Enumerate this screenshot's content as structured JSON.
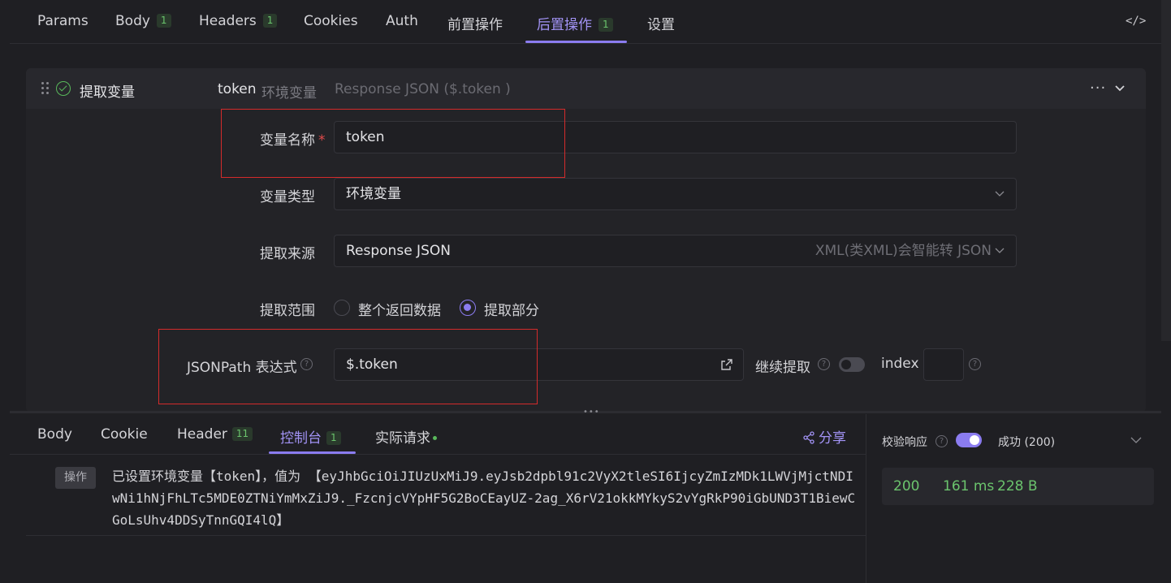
{
  "top_tabs": [
    {
      "label": "Params",
      "badge": ""
    },
    {
      "label": "Body",
      "badge": "1"
    },
    {
      "label": "Headers",
      "badge": "1"
    },
    {
      "label": "Cookies",
      "badge": ""
    },
    {
      "label": "Auth",
      "badge": ""
    },
    {
      "label": "前置操作",
      "badge": ""
    },
    {
      "label": "后置操作",
      "badge": "1"
    },
    {
      "label": "设置",
      "badge": ""
    }
  ],
  "active_top_tab": "后置操作",
  "code_icon_glyph": "</>",
  "extract": {
    "title": "提取变量",
    "summary_name": "token",
    "summary_type": "环境变量",
    "summary_source": "Response JSON ($.token )",
    "more_glyph": "···",
    "fields": {
      "var_name_label": "变量名称",
      "required_mark": "*",
      "var_name_value": "token",
      "var_type_label": "变量类型",
      "var_type_value": "环境变量",
      "source_label": "提取来源",
      "source_value": "Response JSON",
      "source_hint": "XML(类XML)会智能转 JSON",
      "range_label": "提取范围",
      "range_options": [
        "整个返回数据",
        "提取部分"
      ],
      "range_selected": "提取部分",
      "jsonpath_label": "JSONPath 表达式",
      "jsonpath_value": "$.token",
      "continue_label": "继续提取",
      "continue_enabled": false,
      "index_label": "index",
      "index_value": ""
    }
  },
  "bottom_tabs": [
    {
      "label": "Body",
      "badge": ""
    },
    {
      "label": "Cookie",
      "badge": ""
    },
    {
      "label": "Header",
      "badge": "11"
    },
    {
      "label": "控制台",
      "badge": "1"
    },
    {
      "label": "实际请求",
      "badge": ""
    }
  ],
  "active_bottom_tab": "控制台",
  "share_label": "分享",
  "console": {
    "tag": "操作",
    "message": "已设置环境变量【token】，值为 【eyJhbGciOiJIUzUxMiJ9.eyJsb2dpbl91c2VyX2tleSI6IjcyZmIzMDk1LWVjMjctNDIwNi1hNjFhLTc5MDE0ZTNiYmMxZiJ9._FzcnjcVYpHF5G2BoCEayUZ-2ag_X6rV21okkMYkyS2vYgRkP90iGbUND3T1BiewCGoLsUhv4DDSyTnnGQI4lQ】"
  },
  "verify": {
    "label": "校验响应",
    "enabled": true,
    "status": "成功 (200)"
  },
  "metrics": {
    "status_code": "200",
    "time": "161 ms",
    "size": "228 B"
  },
  "colors": {
    "accent": "#8b7cf0",
    "success": "#6bc46d",
    "annotation_box": "#d42b2b",
    "required": "#e34b4b"
  }
}
